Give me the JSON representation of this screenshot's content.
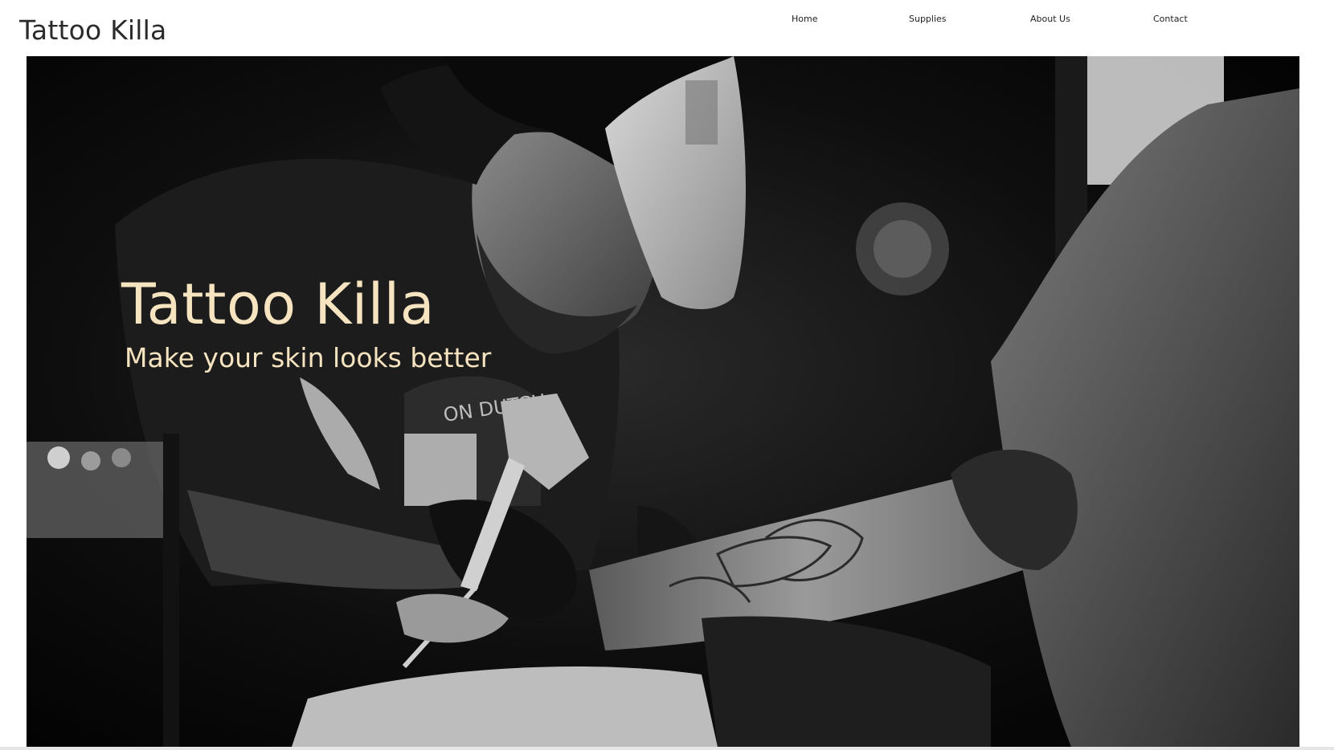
{
  "header": {
    "brand": "Tattoo Killa"
  },
  "nav": {
    "items": [
      {
        "label": "Home"
      },
      {
        "label": "Supplies"
      },
      {
        "label": "About Us"
      },
      {
        "label": "Contact"
      }
    ]
  },
  "hero": {
    "title": "Tattoo Killa",
    "subtitle": "Make your skin looks better",
    "image": "black-and-white photo of a tattoo artist in a cap tattooing a forearm",
    "text_color": "#f6e3bf"
  },
  "colors": {
    "page_background": "#ffffff",
    "brand_text": "#2b2b2b",
    "hero_background": "#050505"
  }
}
